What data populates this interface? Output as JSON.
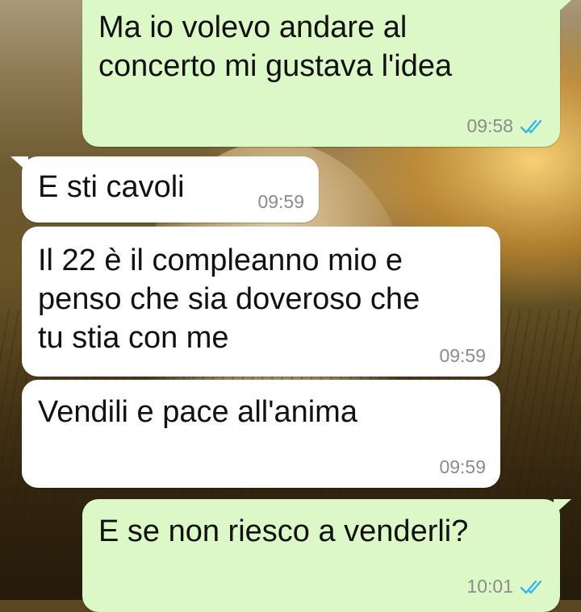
{
  "chat": {
    "messages": [
      {
        "direction": "outgoing",
        "text": "Ma io volevo andare al\nconcerto mi gustava l'idea",
        "time": "09:58",
        "status": "read"
      },
      {
        "direction": "incoming",
        "text": "E sti cavoli",
        "time": "09:59"
      },
      {
        "direction": "incoming",
        "text": "Il 22 è il compleanno mio e\npenso che sia doveroso che\ntu stia con me",
        "time": "09:59"
      },
      {
        "direction": "incoming",
        "text": "Vendili e pace all'anima",
        "time": "09:59"
      },
      {
        "direction": "outgoing",
        "text": "E se non riesco a venderli?",
        "time": "10:01",
        "status": "read"
      }
    ]
  },
  "colors": {
    "outgoing_bubble": "#dcf8c6",
    "incoming_bubble": "#ffffff",
    "read_ticks": "#34b7f1",
    "timestamp": "#8c8c8c"
  },
  "icons": {
    "read_receipt": "double-check-icon"
  }
}
